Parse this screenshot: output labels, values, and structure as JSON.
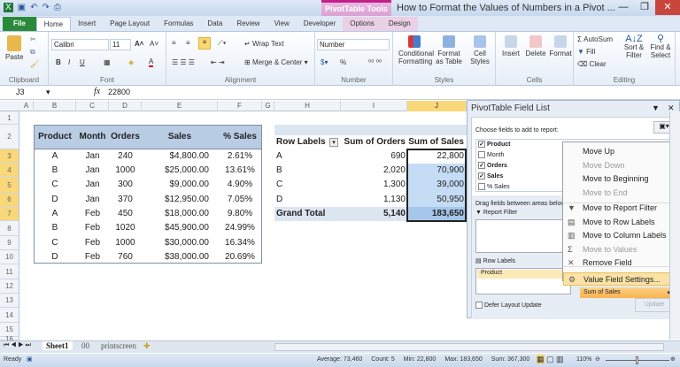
{
  "window": {
    "title": "How to Format the Values of Numbers in a Pivot ...",
    "contextual_tab": "PivotTable Tools",
    "minimize": "—",
    "restore": "❐",
    "close": "✕"
  },
  "tabs": [
    "File",
    "Home",
    "Insert",
    "Page Layout",
    "Formulas",
    "Data",
    "Review",
    "View",
    "Developer",
    "Options",
    "Design"
  ],
  "ribbon": {
    "clipboard": {
      "label": "Clipboard",
      "paste": "Paste"
    },
    "font": {
      "label": "Font",
      "name": "Calibri",
      "size": "11"
    },
    "alignment": {
      "label": "Alignment",
      "wrap": "Wrap Text",
      "merge": "Merge & Center"
    },
    "number": {
      "label": "Number",
      "format": "Number",
      "percent": "%"
    },
    "styles": {
      "label": "Styles",
      "cond": "Conditional Formatting",
      "table": "Format as Table",
      "cell": "Cell Styles"
    },
    "cells": {
      "label": "Cells",
      "insert": "Insert",
      "delete": "Delete",
      "format": "Format"
    },
    "editing": {
      "label": "Editing",
      "autosum": "AutoSum",
      "fill": "Fill",
      "clear": "Clear",
      "sort": "Sort & Filter",
      "find": "Find & Select"
    }
  },
  "formula_bar": {
    "name_box": "J3",
    "fx": "fx",
    "value": "22800"
  },
  "columns": [
    "A",
    "B",
    "C",
    "D",
    "E",
    "F",
    "G",
    "H",
    "I",
    "J"
  ],
  "rows": [
    "1",
    "2",
    "3",
    "4",
    "5",
    "6",
    "7",
    "8",
    "9",
    "10",
    "11",
    "12",
    "13",
    "14",
    "15",
    "16"
  ],
  "source_table": {
    "headers": [
      "Product",
      "Month",
      "Orders",
      "Sales",
      "% Sales"
    ],
    "rows": [
      [
        "A",
        "Jan",
        "240",
        "$4,800.00",
        "2.61%"
      ],
      [
        "B",
        "Jan",
        "1000",
        "$25,000.00",
        "13.61%"
      ],
      [
        "C",
        "Jan",
        "300",
        "$9,000.00",
        "4.90%"
      ],
      [
        "D",
        "Jan",
        "370",
        "$12,950.00",
        "7.05%"
      ],
      [
        "A",
        "Feb",
        "450",
        "$18,000.00",
        "9.80%"
      ],
      [
        "B",
        "Feb",
        "1020",
        "$45,900.00",
        "24.99%"
      ],
      [
        "C",
        "Feb",
        "1000",
        "$30,000.00",
        "16.34%"
      ],
      [
        "D",
        "Feb",
        "760",
        "$38,000.00",
        "20.69%"
      ]
    ]
  },
  "pivot": {
    "headers": [
      "Row Labels",
      "Sum of Orders",
      "Sum of Sales"
    ],
    "rows": [
      [
        "A",
        "690",
        "22,800"
      ],
      [
        "B",
        "2,020",
        "70,900"
      ],
      [
        "C",
        "1,300",
        "39,000"
      ],
      [
        "D",
        "1,130",
        "50,950"
      ]
    ],
    "total": [
      "Grand Total",
      "5,140",
      "183,650"
    ]
  },
  "field_list": {
    "title": "PivotTable Field List",
    "choose": "Choose fields to add to report:",
    "fields": [
      {
        "name": "Product",
        "checked": true
      },
      {
        "name": "Month",
        "checked": false
      },
      {
        "name": "Orders",
        "checked": true
      },
      {
        "name": "Sales",
        "checked": true
      },
      {
        "name": "% Sales",
        "checked": false
      }
    ],
    "drag": "Drag fields between areas below:",
    "report_filter": "Report Filter",
    "row_labels": "Row Labels",
    "row_item": "Product",
    "value_item": "Sum of Sales",
    "defer": "Defer Layout Update",
    "update": "Update"
  },
  "context_menu": [
    {
      "label": "Move Up",
      "disabled": false,
      "icon": ""
    },
    {
      "label": "Move Down",
      "disabled": true,
      "icon": ""
    },
    {
      "label": "Move to Beginning",
      "disabled": false,
      "icon": ""
    },
    {
      "label": "Move to End",
      "disabled": true,
      "icon": ""
    },
    {
      "label": "Move to Report Filter",
      "disabled": false,
      "icon": "filter-icon"
    },
    {
      "label": "Move to Row Labels",
      "disabled": false,
      "icon": "rows-icon"
    },
    {
      "label": "Move to Column Labels",
      "disabled": false,
      "icon": "columns-icon"
    },
    {
      "label": "Move to Values",
      "disabled": true,
      "icon": "sigma-icon"
    },
    {
      "label": "Remove Field",
      "disabled": false,
      "icon": "x-icon"
    },
    {
      "label": "Value Field Settings...",
      "disabled": false,
      "icon": "settings-icon",
      "highlighted": true
    }
  ],
  "sheet_tabs": [
    "Sheet1",
    "00",
    "printscreen"
  ],
  "status": {
    "ready": "Ready",
    "average": "Average: 73,460",
    "count": "Count: 5",
    "min": "Min: 22,800",
    "max": "Max: 183,650",
    "sum": "Sum: 367,300",
    "zoom": "110%"
  },
  "colors": {
    "accent": "#2a8a3a",
    "header_fill": "#b8cce4",
    "selection": "#c5dcf5",
    "highlight": "#fbe3a5"
  }
}
